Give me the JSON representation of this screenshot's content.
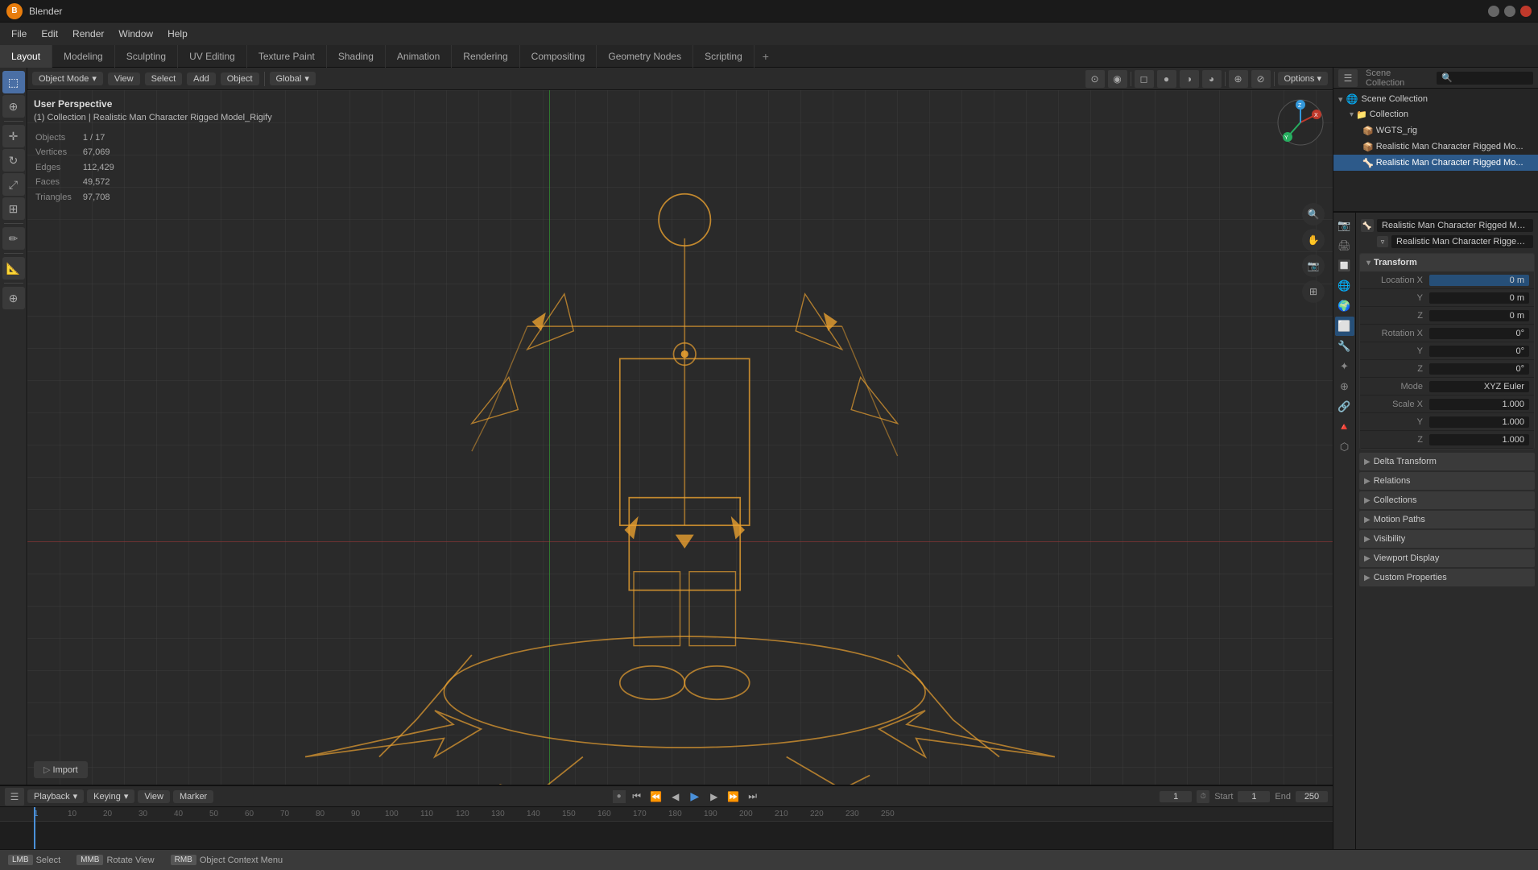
{
  "titlebar": {
    "title": "Blender",
    "window_controls": [
      "minimize",
      "maximize",
      "close"
    ]
  },
  "menubar": {
    "items": [
      "File",
      "Edit",
      "Render",
      "Window",
      "Help"
    ]
  },
  "workspace_tabs": {
    "tabs": [
      "Layout",
      "Modeling",
      "Sculpting",
      "UV Editing",
      "Texture Paint",
      "Shading",
      "Animation",
      "Rendering",
      "Compositing",
      "Geometry Nodes",
      "Scripting"
    ],
    "active": "Layout",
    "add_label": "+"
  },
  "viewport_topbar": {
    "mode_label": "Object Mode",
    "select_label": "Select",
    "add_label": "Add",
    "object_label": "Object",
    "view_label": "View",
    "shading_global": "Global",
    "options_label": "Options ▾"
  },
  "viewport_info": {
    "perspective": "User Perspective",
    "collection_info": "(1) Collection | Realistic Man Character Rigged Model_Rigify",
    "stats": {
      "objects_label": "Objects",
      "objects_val": "1 / 17",
      "vertices_label": "Vertices",
      "vertices_val": "67,069",
      "edges_label": "Edges",
      "edges_val": "112,429",
      "faces_label": "Faces",
      "faces_val": "49,572",
      "triangles_label": "Triangles",
      "triangles_val": "97,708"
    }
  },
  "left_tools": {
    "tools": [
      {
        "name": "select-tool",
        "icon": "⬚",
        "active": true
      },
      {
        "name": "cursor-tool",
        "icon": "⊕"
      },
      {
        "name": "move-tool",
        "icon": "✛"
      },
      {
        "name": "rotate-tool",
        "icon": "↻"
      },
      {
        "name": "scale-tool",
        "icon": "⤢"
      },
      {
        "name": "transform-tool",
        "icon": "⊞"
      },
      {
        "name": "annotate-tool",
        "icon": "✏"
      },
      {
        "name": "measure-tool",
        "icon": "📐"
      },
      {
        "name": "add-tool",
        "icon": "⊕"
      }
    ]
  },
  "right_panel": {
    "scene_collection": {
      "title": "Scene Collection",
      "items": [
        {
          "name": "Collection",
          "indent": 1,
          "icon": "📁",
          "expanded": true
        },
        {
          "name": "WGTS_rig",
          "indent": 2,
          "icon": "📦"
        },
        {
          "name": "Realistic Man Character Rigged Mo...",
          "indent": 2,
          "icon": "📦"
        },
        {
          "name": "Realistic Man Character Rigged Mo...",
          "indent": 2,
          "icon": "🦴",
          "selected": true,
          "highlighted": true
        }
      ]
    },
    "properties": {
      "active_tab": "object",
      "object_name": "Realistic Man Character Rigged Model_R...",
      "data_name": "Realistic Man Character Rigged Mode...",
      "sections": {
        "transform": {
          "title": "Transform",
          "expanded": true,
          "location": {
            "x": "0 m",
            "y": "0 m",
            "z": "0 m"
          },
          "rotation": {
            "x": "0°",
            "y": "0°",
            "z": "0°"
          },
          "mode": "XYZ Euler",
          "scale": {
            "x": "1.000",
            "y": "1.000",
            "z": "1.000"
          }
        },
        "delta_transform": {
          "title": "Delta Transform",
          "expanded": false
        },
        "relations": {
          "title": "Relations",
          "expanded": false
        },
        "collections": {
          "title": "Collections",
          "expanded": false
        },
        "motion_paths": {
          "title": "Motion Paths",
          "expanded": false
        },
        "visibility": {
          "title": "Visibility",
          "expanded": false
        },
        "viewport_display": {
          "title": "Viewport Display",
          "expanded": false
        },
        "custom_properties": {
          "title": "Custom Properties",
          "expanded": false
        }
      }
    }
  },
  "timeline": {
    "playback_label": "Playback",
    "keying_label": "Keying",
    "view_label": "View",
    "marker_label": "Marker",
    "start_label": "Start",
    "start_val": "1",
    "end_label": "End",
    "end_val": "250",
    "current_frame": "1",
    "frame_numbers": [
      "1",
      "10",
      "20",
      "30",
      "40",
      "50",
      "60",
      "70",
      "80",
      "90",
      "100",
      "110",
      "120",
      "130",
      "140",
      "150",
      "160",
      "170",
      "180",
      "190",
      "200",
      "210",
      "220",
      "230",
      "250"
    ]
  },
  "statusbar": {
    "items": [
      {
        "key": "Select",
        "icon": "🖱",
        "label": "Select"
      },
      {
        "key": "Rotate View",
        "icon": "🖱",
        "label": "Rotate View"
      },
      {
        "key": "Object Context Menu",
        "icon": "🖱",
        "label": "Object Context Menu"
      }
    ]
  },
  "import_btn": "Import"
}
